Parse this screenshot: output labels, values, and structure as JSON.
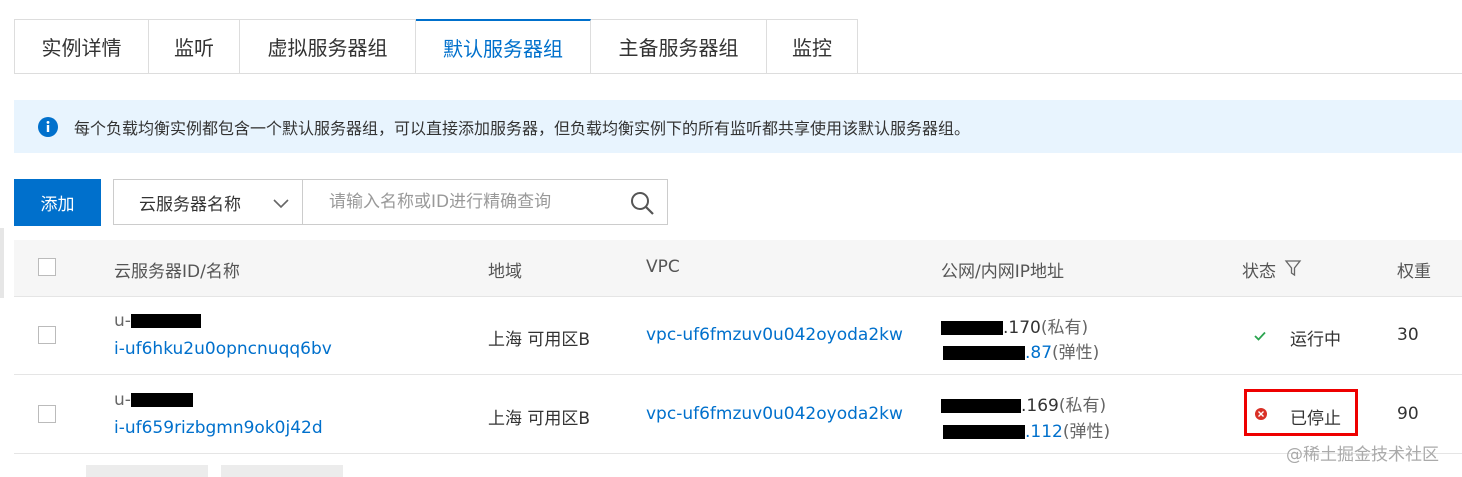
{
  "tabs": [
    {
      "label": "实例详情",
      "active": false
    },
    {
      "label": "监听",
      "active": false
    },
    {
      "label": "虚拟服务器组",
      "active": false
    },
    {
      "label": "默认服务器组",
      "active": true
    },
    {
      "label": "主备服务器组",
      "active": false
    },
    {
      "label": "监控",
      "active": false
    }
  ],
  "banner": {
    "icon": "info-icon",
    "text": "每个负载均衡实例都包含一个默认服务器组，可以直接添加服务器，但负载均衡实例下的所有监听都共享使用该默认服务器组。"
  },
  "toolbar": {
    "add_label": "添加",
    "filter_select": "云服务器名称",
    "search_placeholder": "请输入名称或ID进行精确查询"
  },
  "table": {
    "headers": {
      "name": "云服务器ID/名称",
      "region": "地域",
      "vpc": "VPC",
      "ip": "公网/内网IP地址",
      "status": "状态",
      "weight": "权重"
    },
    "rows": [
      {
        "name_prefix": "u-",
        "id": "i-uf6hku2u0opncnuqq6bv",
        "region": "上海 可用区B",
        "vpc": "vpc-uf6fmzuv0u042oyoda2kw",
        "ip_private": ".170",
        "ip_private_tag": "(私有)",
        "ip_public": ".87",
        "ip_public_tag": "(弹性)",
        "status": "运行中",
        "status_icon": "check-icon",
        "weight": "30"
      },
      {
        "name_prefix": "u-",
        "id": "i-uf659rizbgmn9ok0j42d",
        "region": "上海 可用区B",
        "vpc": "vpc-uf6fmzuv0u042oyoda2kw",
        "ip_private": ".169",
        "ip_private_tag": "(私有)",
        "ip_public": ".112",
        "ip_public_tag": "(弹性)",
        "status": "已停止",
        "status_icon": "error-circle-icon",
        "weight": "90"
      }
    ]
  },
  "watermark": "@稀土掘金技术社区",
  "colors": {
    "accent": "#0070cc",
    "banner_bg": "#e8f4fe",
    "running": "#2aa44f",
    "stopped": "#d93026",
    "highlight": "#ee0000"
  }
}
